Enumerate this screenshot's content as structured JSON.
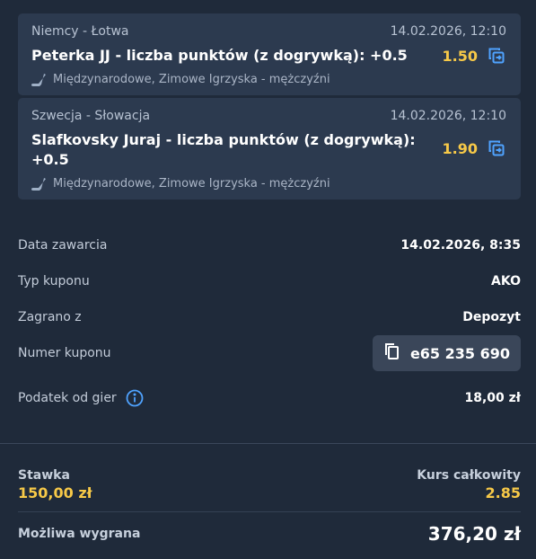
{
  "bets": [
    {
      "match": "Niemcy - Łotwa",
      "datetime": "14.02.2026, 12:10",
      "selection": "Peterka JJ - liczba punktów (z dogrywką): +0.5",
      "odds": "1.50",
      "competition": "Międzynarodowe, Zimowe Igrzyska - mężczyźni",
      "sport_icon": "hockey-stick-icon",
      "action_icon": "copy-bet-icon"
    },
    {
      "match": "Szwecja - Słowacja",
      "datetime": "14.02.2026, 12:10",
      "selection": "Slafkovsky Juraj - liczba punktów (z dogrywką): +0.5",
      "odds": "1.90",
      "competition": "Międzynarodowe, Zimowe Igrzyska - mężczyźni",
      "sport_icon": "hockey-stick-icon",
      "action_icon": "copy-bet-icon"
    }
  ],
  "details": {
    "date_label": "Data zawarcia",
    "date_value": "14.02.2026, 8:35",
    "type_label": "Typ kuponu",
    "type_value": "AKO",
    "played_label": "Zagrano z",
    "played_value": "Depozyt",
    "number_label": "Numer kuponu",
    "number_value": "e65 235 690",
    "tax_label": "Podatek od gier",
    "tax_value": "18,00 zł"
  },
  "summary": {
    "stake_label": "Stawka",
    "stake_value": "150,00 zł",
    "total_odds_label": "Kurs całkowity",
    "total_odds_value": "2.85",
    "win_label": "Możliwa wygrana",
    "win_value": "376,20 zł"
  },
  "colors": {
    "background": "#1f2a3a",
    "card": "#2c3a4f",
    "accent_odds": "#f7c948",
    "accent_icon": "#4fa3ff"
  }
}
